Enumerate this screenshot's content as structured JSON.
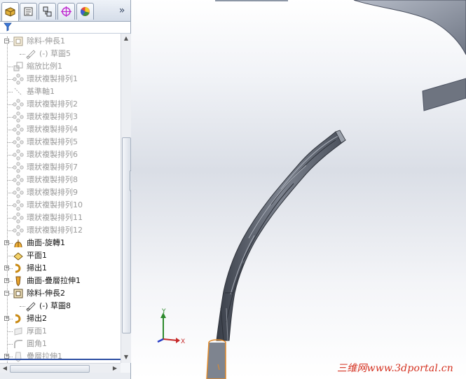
{
  "feature_tree": {
    "tabs": [
      {
        "icon": "feature-manager-icon"
      },
      {
        "icon": "property-manager-icon"
      },
      {
        "icon": "configuration-manager-icon"
      },
      {
        "icon": "dimxpert-icon"
      },
      {
        "icon": "display-manager-icon"
      }
    ],
    "more_icon": "»",
    "filter_icon": "filter-icon",
    "items": [
      {
        "label": "除料-伸長1",
        "icon": "cut-extrude-icon",
        "state": "dim",
        "expander": "−"
      },
      {
        "label": "(-) 草圖5",
        "icon": "sketch-icon",
        "state": "dim"
      },
      {
        "label": "縮放比例1",
        "icon": "scale-icon",
        "state": "dim"
      },
      {
        "label": "環狀複製排列1",
        "icon": "circular-pattern-icon",
        "state": "dim"
      },
      {
        "label": "基準軸1",
        "icon": "axis-icon",
        "state": "dim"
      },
      {
        "label": "環狀複製排列2",
        "icon": "circular-pattern-icon",
        "state": "dim"
      },
      {
        "label": "環狀複製排列3",
        "icon": "circular-pattern-icon",
        "state": "dim"
      },
      {
        "label": "環狀複製排列4",
        "icon": "circular-pattern-icon",
        "state": "dim"
      },
      {
        "label": "環狀複製排列5",
        "icon": "circular-pattern-icon",
        "state": "dim"
      },
      {
        "label": "環狀複製排列6",
        "icon": "circular-pattern-icon",
        "state": "dim"
      },
      {
        "label": "環狀複製排列7",
        "icon": "circular-pattern-icon",
        "state": "dim"
      },
      {
        "label": "環狀複製排列8",
        "icon": "circular-pattern-icon",
        "state": "dim"
      },
      {
        "label": "環狀複製排列9",
        "icon": "circular-pattern-icon",
        "state": "dim"
      },
      {
        "label": "環狀複製排列10",
        "icon": "circular-pattern-icon",
        "state": "dim"
      },
      {
        "label": "環狀複製排列11",
        "icon": "circular-pattern-icon",
        "state": "dim"
      },
      {
        "label": "環狀複製排列12",
        "icon": "circular-pattern-icon",
        "state": "dim"
      },
      {
        "label": "曲面-旋轉1",
        "icon": "surface-revolve-icon",
        "state": "active",
        "expander": "+"
      },
      {
        "label": "平面1",
        "icon": "plane-icon",
        "state": "active"
      },
      {
        "label": "掃出1",
        "icon": "sweep-icon",
        "state": "active",
        "expander": "+"
      },
      {
        "label": "曲面-疊層拉伸1",
        "icon": "surface-loft-icon",
        "state": "active",
        "expander": "+"
      },
      {
        "label": "除料-伸長2",
        "icon": "cut-extrude-icon",
        "state": "active",
        "expander": "−"
      },
      {
        "label": "(-) 草圖8",
        "icon": "sketch-icon",
        "state": "active"
      },
      {
        "label": "掃出2",
        "icon": "sweep-icon",
        "state": "active",
        "expander": "+"
      },
      {
        "label": "厚面1",
        "icon": "thicken-icon",
        "state": "dim"
      },
      {
        "label": "圓角1",
        "icon": "fillet-icon",
        "state": "dim"
      },
      {
        "label": "疊層拉伸1",
        "icon": "loft-icon",
        "state": "dim",
        "expander": "+"
      }
    ]
  },
  "viewport": {
    "triad_labels": {
      "x": "X",
      "y": "Y"
    },
    "watermark": "三维网www.3dportal.cn"
  },
  "colors": {
    "rollback_bar": "#2d4fa3",
    "model_gray": "#5b606b",
    "selection_orange": "#e38a28",
    "watermark_red": "#d4301f"
  }
}
